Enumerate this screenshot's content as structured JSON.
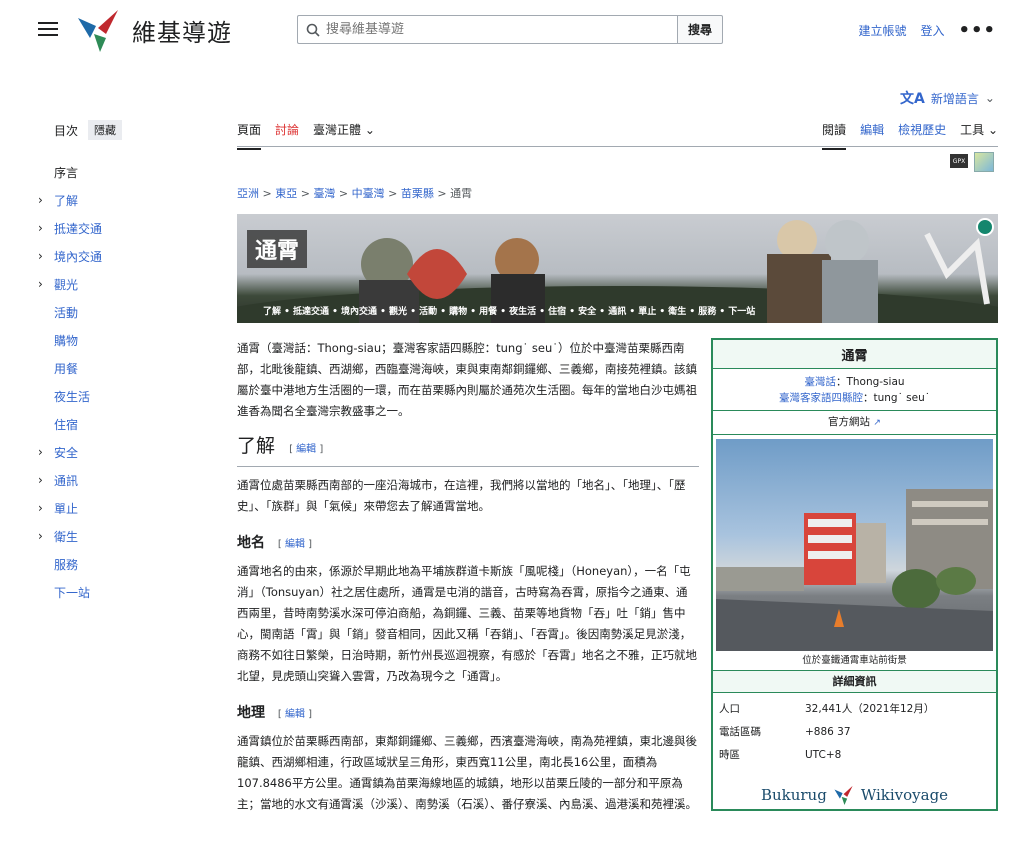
{
  "header": {
    "site_name": "維基導遊",
    "search_placeholder": "搜尋維基導遊",
    "search_button": "搜尋",
    "create_account": "建立帳號",
    "login": "登入",
    "more_icon": "ellipsis-icon"
  },
  "lang": {
    "label": "新增語言"
  },
  "tabs": {
    "left": [
      "頁面",
      "討論",
      "臺灣正體"
    ],
    "right": [
      "閱讀",
      "編輯",
      "檢視歷史",
      "工具"
    ]
  },
  "toc": {
    "title": "目次",
    "hide": "隱藏",
    "items": [
      {
        "label": "序言",
        "expandable": false
      },
      {
        "label": "了解",
        "expandable": true
      },
      {
        "label": "抵達交通",
        "expandable": true
      },
      {
        "label": "境內交通",
        "expandable": true
      },
      {
        "label": "觀光",
        "expandable": true
      },
      {
        "label": "活動",
        "expandable": false
      },
      {
        "label": "購物",
        "expandable": false
      },
      {
        "label": "用餐",
        "expandable": false
      },
      {
        "label": "夜生活",
        "expandable": false
      },
      {
        "label": "住宿",
        "expandable": false
      },
      {
        "label": "安全",
        "expandable": true
      },
      {
        "label": "通訊",
        "expandable": true
      },
      {
        "label": "單止",
        "expandable": true
      },
      {
        "label": "衛生",
        "expandable": true
      },
      {
        "label": "服務",
        "expandable": false
      },
      {
        "label": "下一站",
        "expandable": false
      }
    ]
  },
  "breadcrumb": [
    "亞洲",
    "東亞",
    "臺灣",
    "中臺灣",
    "苗栗縣",
    "通霄"
  ],
  "banner": {
    "title": "通霄",
    "nav": "了解 • 抵達交通 • 境內交通 • 觀光 • 活動 • 購物 • 用餐 • 夜生活 • 住宿 • 安全 • 通訊 • 單止 • 衛生 • 服務 • 下一站"
  },
  "article": {
    "intro": "通霄（臺灣話：Thong-siau；臺灣客家語四縣腔：tung˙ seu˙）位於中臺灣苗栗縣西南部，北毗後龍鎮、西湖鄉，西臨臺灣海峽，東與東南鄰銅鑼鄉、三義鄉，南接苑裡鎮。該鎮屬於臺中港地方生活圈的一環，而在苗栗縣內則屬於通苑次生活圈。每年的當地白沙屯媽祖進香為聞名全臺灣宗教盛事之一。",
    "h_understand": "了解",
    "edit_label": "編輯",
    "understand_p": "通霄位處苗栗縣西南部的一座沿海城市，在這裡，我們將以當地的「地名」、「地理」、「歷史」、「族群」與「氣候」來帶您去了解通霄當地。",
    "h_name": "地名",
    "name_p": "通霄地名的由來，係源於早期此地為平埔族群道卡斯族「風呢棧」（Honeyan），一名「屯消」（Tonsuyan）社之居住處所，通霄是屯消的諧音，古時寫為吞霄，原指今之通東、通西兩里，昔時南勢溪水深可停泊商船，為銅鑼、三義、苗栗等地貨物「吞」吐「銷」售中心，閩南語「霄」與「銷」發音相同，因此又稱「吞銷」、「吞霄」。後因南勢溪足見淤淺，商務不如往日繁榮，日治時期，新竹州長巡迴視察，有感於「吞霄」地名之不雅，正巧就地北望，見虎頭山突聳入雲霄，乃改為現今之「通霄」。",
    "h_geo": "地理",
    "geo_p": "通霄鎮位於苗栗縣西南部，東鄰銅鑼鄉、三義鄉，西濱臺灣海峽，南為苑裡鎮，東北邊與後龍鎮、西湖鄉相連，行政區域狀呈三角形，東西寬11公里，南北長16公里，面積為107.8486平方公里。通霄鎮為苗栗海線地區的城鎮，地形以苗栗丘陵的一部分和平原為主；當地的水文有通霄溪（沙溪）、南勢溪（石溪）、番仔寮溪、內島溪、過港溪和苑裡溪。"
  },
  "infobox": {
    "title": "通霄",
    "pron1_label": "臺灣話",
    "pron1_value": "：Thong-siau",
    "pron2_label": "臺灣客家語四縣腔",
    "pron2_value": "：tung˙ seu˙",
    "official_site": "官方網站",
    "caption": "位於臺鐵通霄車站前街景",
    "details_head": "詳細資訊",
    "rows": [
      {
        "k": "人口",
        "v": "32,441人（2021年12月）"
      },
      {
        "k": "電話區碼",
        "v": "+886 37"
      },
      {
        "k": "時區",
        "v": "UTC+8"
      }
    ],
    "footer_left": "Bukurug",
    "footer_right": "Wikivoyage"
  }
}
